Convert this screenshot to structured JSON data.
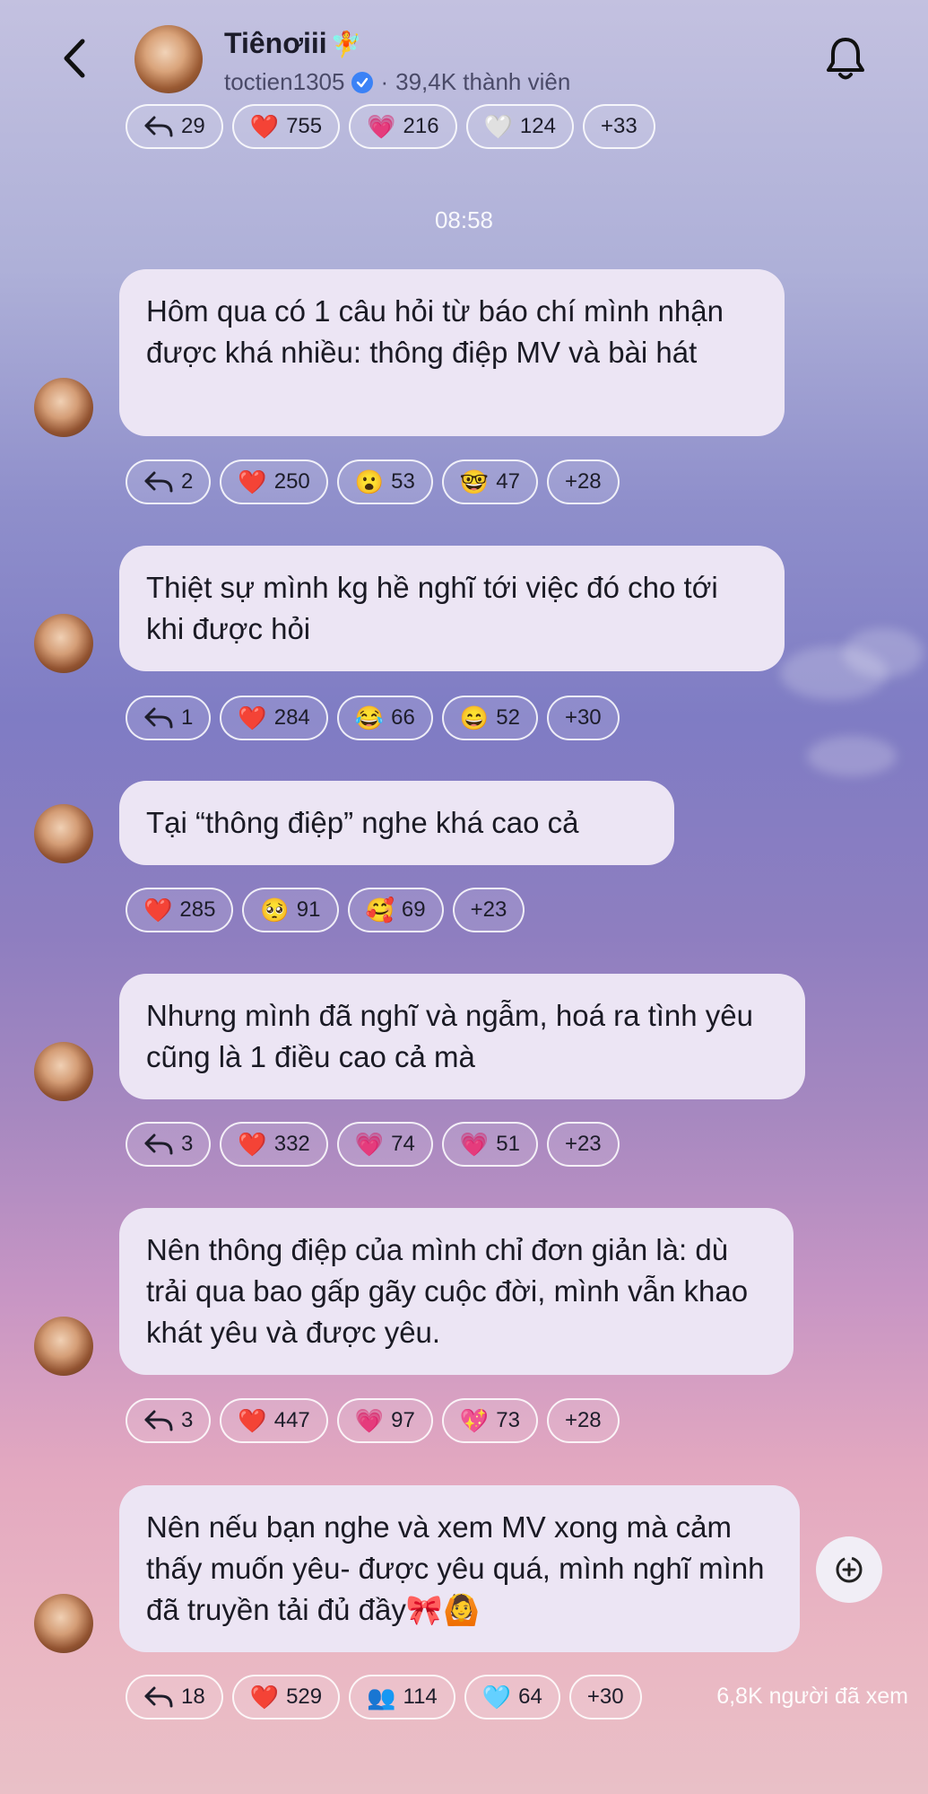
{
  "header": {
    "title": "Tiênơiii",
    "title_emoji": "🧚",
    "username": "toctien1305",
    "separator": "·",
    "members": "39,4K thành viên"
  },
  "top_reactions": [
    {
      "icon": "reply",
      "count": "29"
    },
    {
      "icon": "❤️",
      "count": "755"
    },
    {
      "icon": "💗",
      "count": "216"
    },
    {
      "icon": "🤍",
      "count": "124"
    },
    {
      "icon": "",
      "count": "+33"
    }
  ],
  "time": "08:58",
  "messages": [
    {
      "text": "Hôm qua có 1 câu hỏi từ báo chí mình nhận được khá nhiều: thông điệp MV và bài hát",
      "reactions": [
        {
          "icon": "reply",
          "count": "2"
        },
        {
          "icon": "❤️",
          "count": "250"
        },
        {
          "icon": "😮",
          "count": "53"
        },
        {
          "icon": "🤓",
          "count": "47"
        },
        {
          "icon": "",
          "count": "+28"
        }
      ]
    },
    {
      "text": "Thiệt sự mình kg hề nghĩ tới việc đó cho tới khi được hỏi",
      "reactions": [
        {
          "icon": "reply",
          "count": "1"
        },
        {
          "icon": "❤️",
          "count": "284"
        },
        {
          "icon": "😂",
          "count": "66"
        },
        {
          "icon": "😄",
          "count": "52"
        },
        {
          "icon": "",
          "count": "+30"
        }
      ]
    },
    {
      "text": "Tại “thông điệp” nghe khá cao cả",
      "reactions": [
        {
          "icon": "❤️",
          "count": "285"
        },
        {
          "icon": "🥺",
          "count": "91"
        },
        {
          "icon": "🥰",
          "count": "69"
        },
        {
          "icon": "",
          "count": "+23"
        }
      ]
    },
    {
      "text": "Nhưng mình đã nghĩ và ngẫm, hoá ra tình yêu cũng là 1 điều cao cả mà",
      "reactions": [
        {
          "icon": "reply",
          "count": "3"
        },
        {
          "icon": "❤️",
          "count": "332"
        },
        {
          "icon": "💗",
          "count": "74"
        },
        {
          "icon": "💗",
          "count": "51"
        },
        {
          "icon": "",
          "count": "+23"
        }
      ]
    },
    {
      "text": "Nên thông điệp của mình chỉ đơn giản là: dù trải qua bao gấp gãy cuộc đời, mình vẫn khao khát yêu và được yêu.",
      "reactions": [
        {
          "icon": "reply",
          "count": "3"
        },
        {
          "icon": "❤️",
          "count": "447"
        },
        {
          "icon": "💗",
          "count": "97"
        },
        {
          "icon": "💖",
          "count": "73"
        },
        {
          "icon": "",
          "count": "+28"
        }
      ]
    },
    {
      "text": "Nên nếu bạn nghe và xem MV xong mà cảm thấy muốn yêu- được yêu quá, mình nghĩ mình đã truyền tải đủ đầy🎀🙆",
      "reactions": [
        {
          "icon": "reply",
          "count": "18"
        },
        {
          "icon": "❤️",
          "count": "529"
        },
        {
          "icon": "👥",
          "count": "114"
        },
        {
          "icon": "🩵",
          "count": "64"
        },
        {
          "icon": "",
          "count": "+30"
        }
      ]
    }
  ],
  "footer": {
    "views": "6,8K người đã xem"
  }
}
